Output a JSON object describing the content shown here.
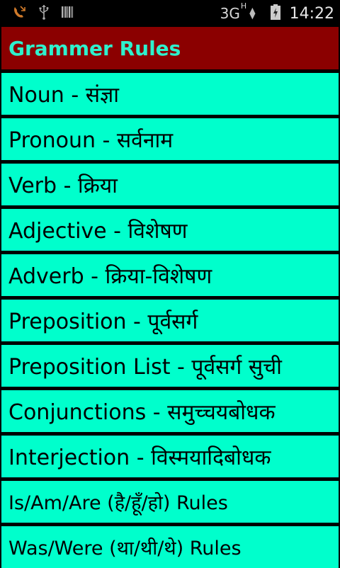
{
  "status_bar": {
    "network": "3G",
    "network_sup": "H",
    "time": "14:22",
    "icons": [
      "missed-call-icon",
      "usb-icon",
      "barcode-icon",
      "signal-icon",
      "battery-charging-icon"
    ]
  },
  "header": {
    "title": "Grammer Rules"
  },
  "menu": {
    "items": [
      {
        "label": "Noun - संज्ञा"
      },
      {
        "label": "Pronoun - सर्वनाम"
      },
      {
        "label": "Verb - क्रिया"
      },
      {
        "label": "Adjective - विशेषण"
      },
      {
        "label": "Adverb - क्रिया-विशेषण"
      },
      {
        "label": "Preposition - पूर्वसर्ग"
      },
      {
        "label": "Preposition List - पूर्वसर्ग सुची"
      },
      {
        "label": "Conjunctions - समुच्चयबोधक"
      },
      {
        "label": "Interjection - विस्मयादिबोधक"
      },
      {
        "label": "Is/Am/Are (है/हूँ/हो) Rules"
      },
      {
        "label": "Was/Were (था/थी/थे) Rules"
      }
    ]
  },
  "colors": {
    "header_bg": "#8b0000",
    "header_text": "#2ef1cd",
    "item_bg": "#00ffcc",
    "background": "#000000"
  }
}
